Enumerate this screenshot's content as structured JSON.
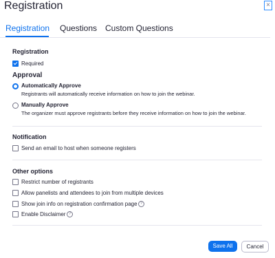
{
  "dialog": {
    "title": "Registration",
    "close_glyph": "×"
  },
  "tabs": [
    {
      "label": "Registration",
      "active": true
    },
    {
      "label": "Questions",
      "active": false
    },
    {
      "label": "Custom Questions",
      "active": false
    }
  ],
  "registration": {
    "heading": "Registration",
    "required_label": "Required",
    "required_checked": true
  },
  "approval": {
    "heading": "Approval",
    "options": [
      {
        "label": "Automatically Approve",
        "description": "Registrants will automatically receive information on how to join the webinar.",
        "selected": true
      },
      {
        "label": "Manually Approve",
        "description": "The organizer must approve registrants before they receive information on how to join the webinar.",
        "selected": false
      }
    ]
  },
  "notification": {
    "heading": "Notification",
    "email_host_label": "Send an email to host when someone registers",
    "email_host_checked": false
  },
  "other_options": {
    "heading": "Other options",
    "items": [
      {
        "label": "Restrict number of registrants",
        "checked": false,
        "help": false
      },
      {
        "label": "Allow panelists and attendees to join from multiple devices",
        "checked": false,
        "help": false
      },
      {
        "label": "Show join info on registration confirmation page",
        "checked": false,
        "help": true
      },
      {
        "label": "Enable Disclaimer",
        "checked": false,
        "help": true
      }
    ],
    "help_glyph": "?"
  },
  "footer": {
    "save_label": "Save All",
    "cancel_label": "Cancel"
  },
  "colors": {
    "accent": "#0e72ed",
    "text": "#232333",
    "divider": "#e4e4ed",
    "muted": "#747487"
  },
  "icons": {
    "close": "close-icon",
    "help": "help-icon",
    "checkbox_check": "checkmark-icon"
  }
}
